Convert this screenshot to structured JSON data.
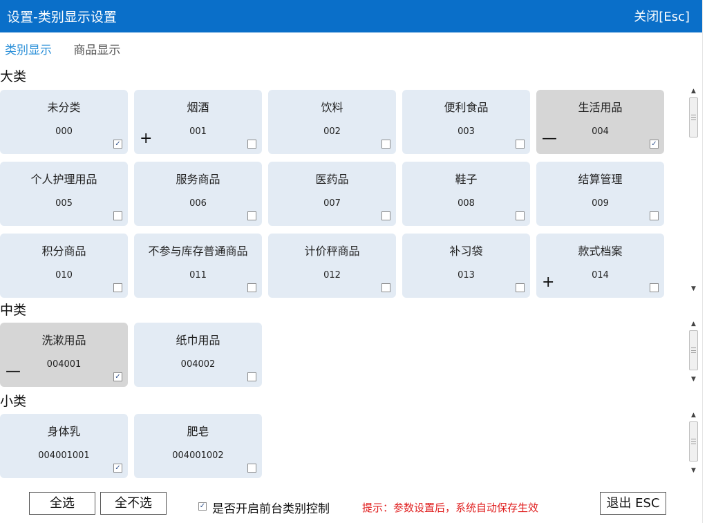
{
  "window": {
    "title": "设置-类别显示设置",
    "close_label": "关闭[Esc]"
  },
  "tabs": [
    {
      "label": "类别显示"
    },
    {
      "label": "商品显示"
    }
  ],
  "sections": {
    "major": {
      "label": "大类",
      "items": [
        {
          "name": "未分类",
          "code": "000",
          "checked": true,
          "selected": false,
          "expander": ""
        },
        {
          "name": "烟酒",
          "code": "001",
          "checked": false,
          "selected": false,
          "expander": "+"
        },
        {
          "name": "饮料",
          "code": "002",
          "checked": false,
          "selected": false,
          "expander": ""
        },
        {
          "name": "便利食品",
          "code": "003",
          "checked": false,
          "selected": false,
          "expander": ""
        },
        {
          "name": "生活用品",
          "code": "004",
          "checked": true,
          "selected": true,
          "expander": "—"
        },
        {
          "name": "个人护理用品",
          "code": "005",
          "checked": false,
          "selected": false,
          "expander": ""
        },
        {
          "name": "服务商品",
          "code": "006",
          "checked": false,
          "selected": false,
          "expander": ""
        },
        {
          "name": "医药品",
          "code": "007",
          "checked": false,
          "selected": false,
          "expander": ""
        },
        {
          "name": "鞋子",
          "code": "008",
          "checked": false,
          "selected": false,
          "expander": ""
        },
        {
          "name": "结算管理",
          "code": "009",
          "checked": false,
          "selected": false,
          "expander": ""
        },
        {
          "name": "积分商品",
          "code": "010",
          "checked": false,
          "selected": false,
          "expander": ""
        },
        {
          "name": "不参与库存普通商品",
          "code": "011",
          "checked": false,
          "selected": false,
          "expander": ""
        },
        {
          "name": "计价秤商品",
          "code": "012",
          "checked": false,
          "selected": false,
          "expander": ""
        },
        {
          "name": "补习袋",
          "code": "013",
          "checked": false,
          "selected": false,
          "expander": ""
        },
        {
          "name": "款式档案",
          "code": "014",
          "checked": false,
          "selected": false,
          "expander": "+"
        }
      ]
    },
    "middle": {
      "label": "中类",
      "items": [
        {
          "name": "洗漱用品",
          "code": "004001",
          "checked": true,
          "selected": true,
          "expander": "—"
        },
        {
          "name": "纸巾用品",
          "code": "004002",
          "checked": false,
          "selected": false,
          "expander": ""
        }
      ]
    },
    "minor": {
      "label": "小类",
      "items": [
        {
          "name": "身体乳",
          "code": "004001001",
          "checked": true,
          "selected": false,
          "expander": ""
        },
        {
          "name": "肥皂",
          "code": "004001002",
          "checked": false,
          "selected": false,
          "expander": ""
        }
      ]
    }
  },
  "footer": {
    "select_all": "全选",
    "select_none": "全不选",
    "frontend_control_label": "是否开启前台类别控制",
    "frontend_control_checked": true,
    "hint": "提示：参数设置后，系统自动保存生效",
    "exit": "退出 ESC"
  },
  "icons": {
    "checkbox_checked": "check-icon",
    "expand": "plus-icon",
    "collapse": "minus-icon",
    "scroll_up": "triangle-up-icon",
    "scroll_down": "triangle-down-icon"
  },
  "colors": {
    "titlebar": "#0a6fc9",
    "active_tab": "#2a8fd8",
    "card": "#e3ebf4",
    "card_selected": "#d6d6d6",
    "hint": "#e02020"
  }
}
